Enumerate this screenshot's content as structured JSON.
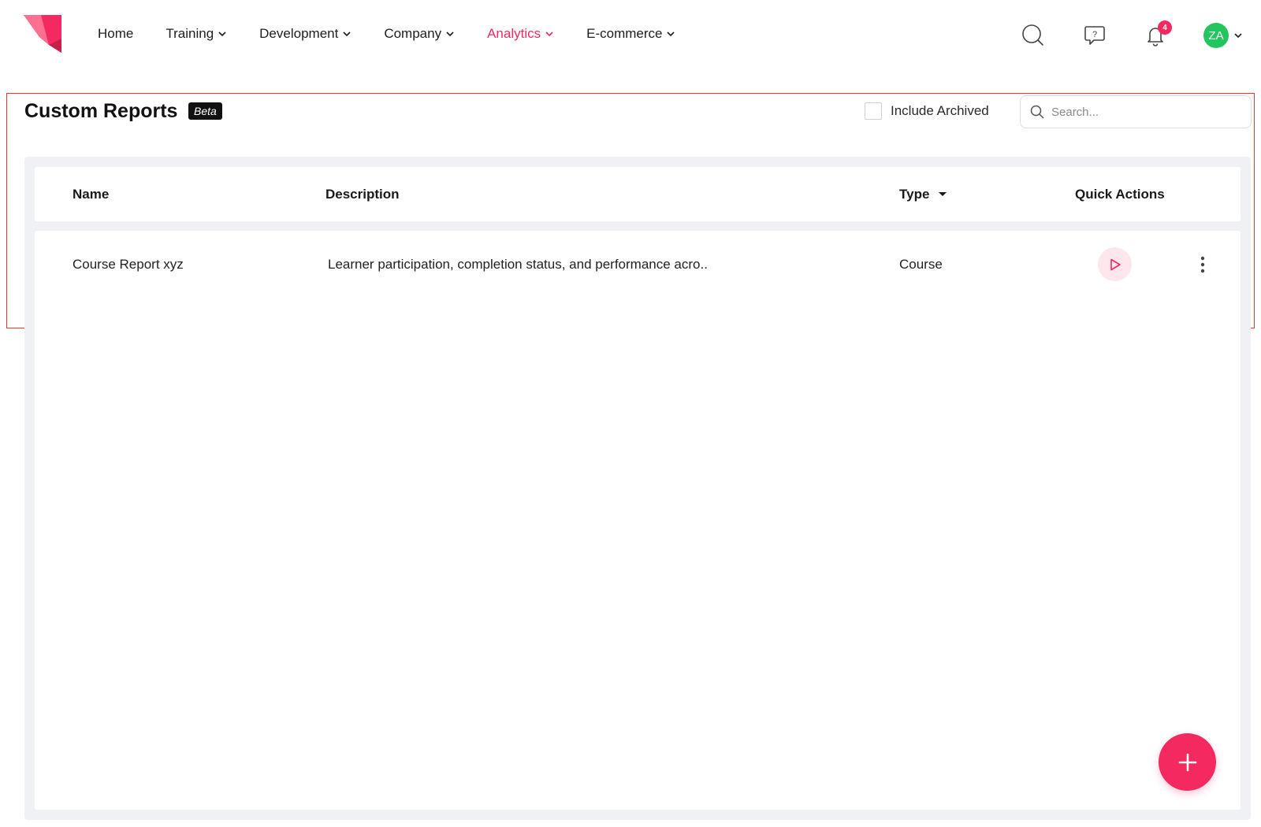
{
  "nav": {
    "items": [
      {
        "label": "Home",
        "has_dropdown": false,
        "active": false
      },
      {
        "label": "Training",
        "has_dropdown": true,
        "active": false
      },
      {
        "label": "Development",
        "has_dropdown": true,
        "active": false
      },
      {
        "label": "Company",
        "has_dropdown": true,
        "active": false
      },
      {
        "label": "Analytics",
        "has_dropdown": true,
        "active": true
      },
      {
        "label": "E-commerce",
        "has_dropdown": true,
        "active": false
      }
    ],
    "notification_count": "4",
    "user_initials": "ZA"
  },
  "header": {
    "title": "Custom Reports",
    "badge": "Beta",
    "include_archived_label": "Include Archived",
    "include_archived_checked": false,
    "search_placeholder": "Search..."
  },
  "table": {
    "columns": {
      "name": "Name",
      "description": "Description",
      "type": "Type",
      "quick_actions": "Quick Actions"
    },
    "rows": [
      {
        "name": "Course Report xyz",
        "description": "Learner participation, completion status, and performance acro..",
        "type": "Course"
      }
    ]
  },
  "colors": {
    "accent": "#f4295f",
    "avatar": "#22c55e",
    "panel_bg": "#f0f1f5",
    "highlight": "#e53935"
  },
  "icons": [
    "logo-icon",
    "search-icon",
    "help-chat-icon",
    "bell-icon",
    "chevron-down-icon",
    "play-icon",
    "more-vertical-icon",
    "plus-icon"
  ]
}
